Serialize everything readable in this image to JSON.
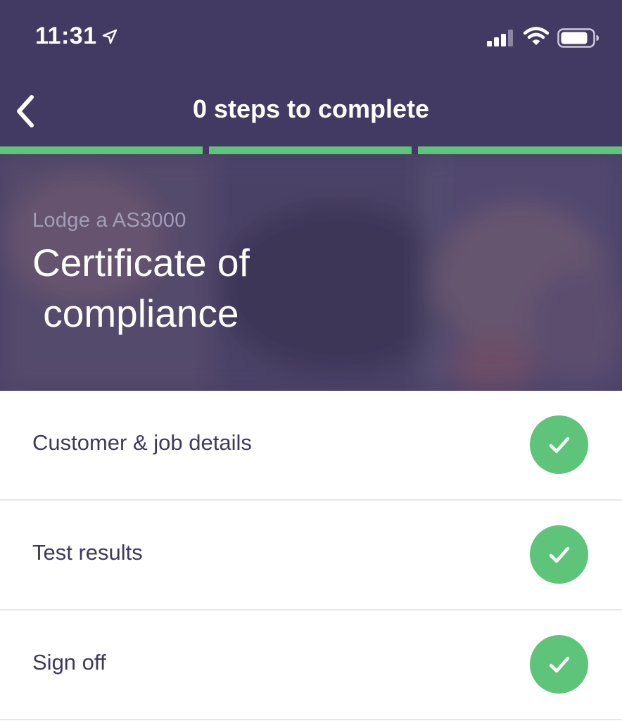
{
  "status_bar": {
    "time": "11:31",
    "icons": [
      "location-arrow-icon",
      "cellular-signal-icon",
      "wifi-icon",
      "battery-icon"
    ]
  },
  "nav": {
    "back_icon": "chevron-left-icon",
    "title": "0 steps to complete"
  },
  "progress": {
    "segments_total": 3,
    "segments_complete": 3,
    "color": "#5ec479"
  },
  "hero": {
    "subtitle": "Lodge a AS3000",
    "title": "Certificate of\n compliance"
  },
  "steps": [
    {
      "label": "Customer & job details",
      "status": "complete",
      "icon": "check-circle-icon"
    },
    {
      "label": "Test results",
      "status": "complete",
      "icon": "check-circle-icon"
    },
    {
      "label": "Sign off",
      "status": "complete",
      "icon": "check-circle-icon"
    }
  ],
  "colors": {
    "header": "#433a63",
    "accent": "#5ec479",
    "text_dark": "#3e3a5a",
    "subtitle": "#a39db9"
  }
}
